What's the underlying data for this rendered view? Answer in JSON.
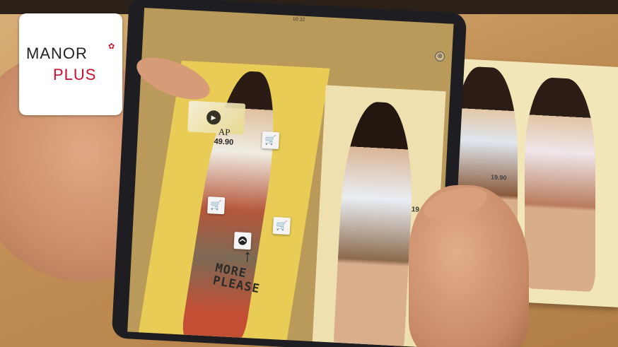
{
  "logo": {
    "line1": "MANOR",
    "line2": "PLUS",
    "flower_icon": "flower-icon"
  },
  "tablet": {
    "status_time": "10:32",
    "close_symbol": "⊗",
    "catalog": {
      "brand": "AP",
      "price_left": "49.90",
      "price_right": "19.9",
      "handwritten_line1": "MORE",
      "handwritten_line2": "PLEASE",
      "cart_icon": "🛒",
      "play_symbol": "▶",
      "hanger_icon": "hanger-icon"
    }
  },
  "paper": {
    "price": "19.90"
  },
  "colors": {
    "brand_red": "#c8102e",
    "page_yellow": "#e8cc55"
  }
}
